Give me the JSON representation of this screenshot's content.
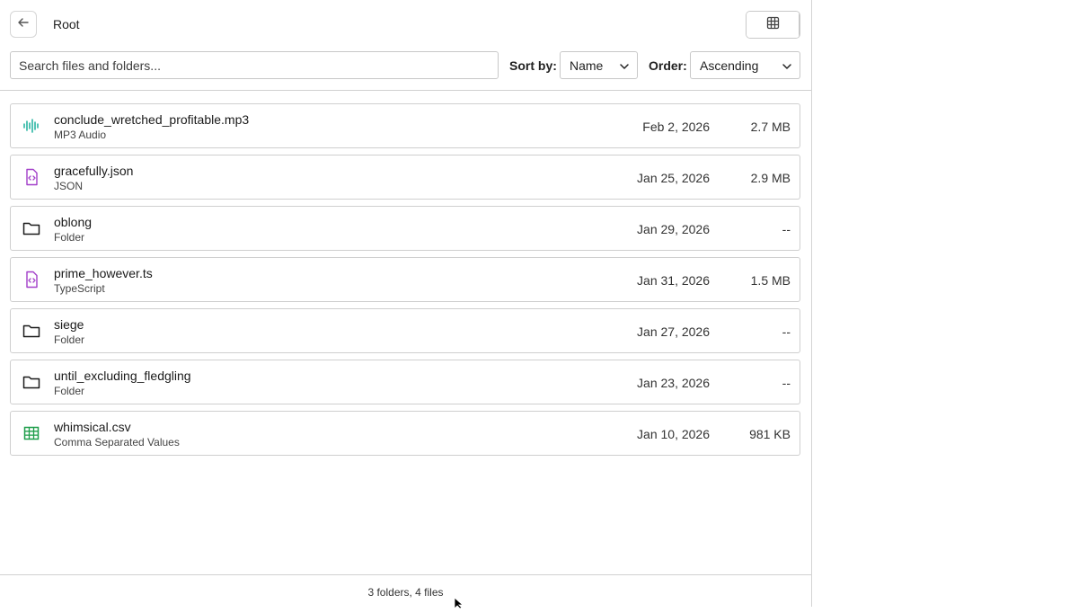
{
  "header": {
    "breadcrumb": "Root",
    "back_icon": "arrow-left-icon",
    "view_modes": [
      {
        "name": "grid",
        "icon": "grid-icon",
        "active": false
      },
      {
        "name": "list",
        "icon": "list-icon",
        "active": true
      }
    ]
  },
  "filters": {
    "search_placeholder": "Search files and folders...",
    "sort_label": "Sort by:",
    "sort_value": "Name",
    "order_label": "Order:",
    "order_value": "Ascending"
  },
  "items": [
    {
      "name": "conclude_wretched_profitable.mp3",
      "type": "MP3 Audio",
      "date": "Feb 2, 2026",
      "size": "2.7 MB",
      "icon": "audio-waveform-icon"
    },
    {
      "name": "gracefully.json",
      "type": "JSON",
      "date": "Jan 25, 2026",
      "size": "2.9 MB",
      "icon": "code-file-icon"
    },
    {
      "name": "oblong",
      "type": "Folder",
      "date": "Jan 29, 2026",
      "size": "--",
      "icon": "folder-icon"
    },
    {
      "name": "prime_however.ts",
      "type": "TypeScript",
      "date": "Jan 31, 2026",
      "size": "1.5 MB",
      "icon": "code-file-icon"
    },
    {
      "name": "siege",
      "type": "Folder",
      "date": "Jan 27, 2026",
      "size": "--",
      "icon": "folder-icon"
    },
    {
      "name": "until_excluding_fledgling",
      "type": "Folder",
      "date": "Jan 23, 2026",
      "size": "--",
      "icon": "folder-icon"
    },
    {
      "name": "whimsical.csv",
      "type": "Comma Separated Values",
      "date": "Jan 10, 2026",
      "size": "981 KB",
      "icon": "spreadsheet-icon"
    }
  ],
  "status": "3 folders, 4 files",
  "colors": {
    "audio": "#2bb5a3",
    "code": "#a23fc9",
    "spreadsheet": "#1e9e4a",
    "folder": "#1a1a1a",
    "active_toggle": "#dde8fb"
  }
}
